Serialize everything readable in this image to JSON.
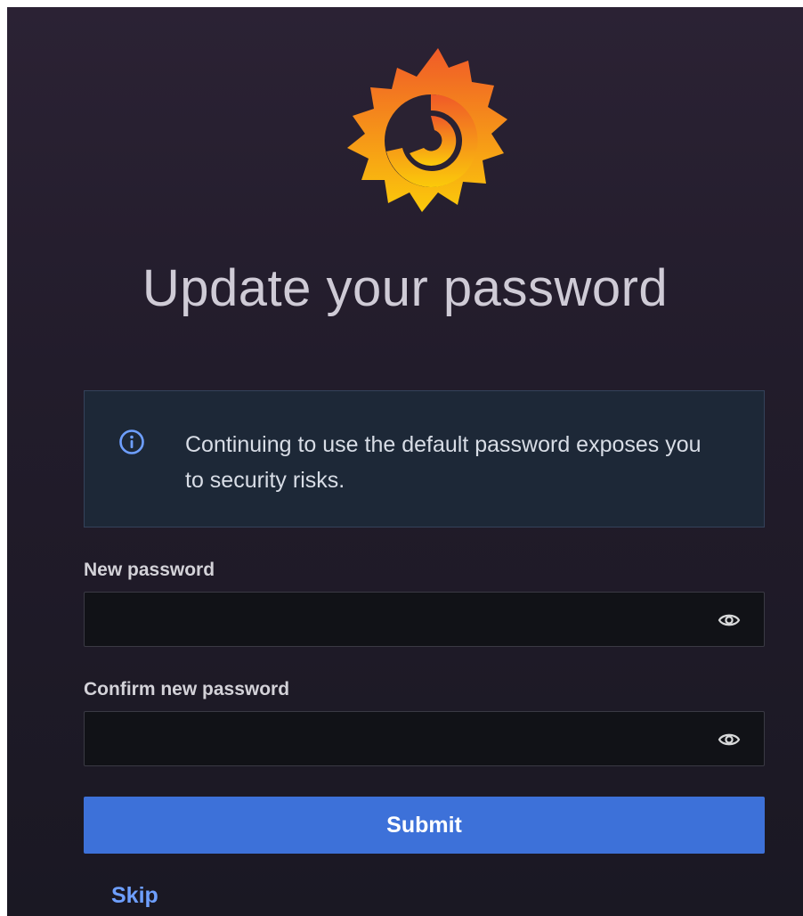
{
  "page": {
    "title": "Update your password"
  },
  "alert": {
    "icon": "info-circle-icon",
    "message": "Continuing to use the default password exposes you to security risks."
  },
  "form": {
    "new_password": {
      "label": "New password",
      "value": "",
      "icon": "eye-icon"
    },
    "confirm_password": {
      "label": "Confirm new password",
      "value": "",
      "icon": "eye-icon"
    },
    "submit_label": "Submit",
    "skip_label": "Skip"
  },
  "colors": {
    "background_top": "#2b2234",
    "background_bottom": "#1a1823",
    "alert_bg": "#1d2837",
    "info_icon": "#6e9fff",
    "submit_bg": "#3d71d9",
    "link": "#6e9fff",
    "logo_orange": "#f05a28",
    "logo_yellow": "#fbca0a"
  }
}
